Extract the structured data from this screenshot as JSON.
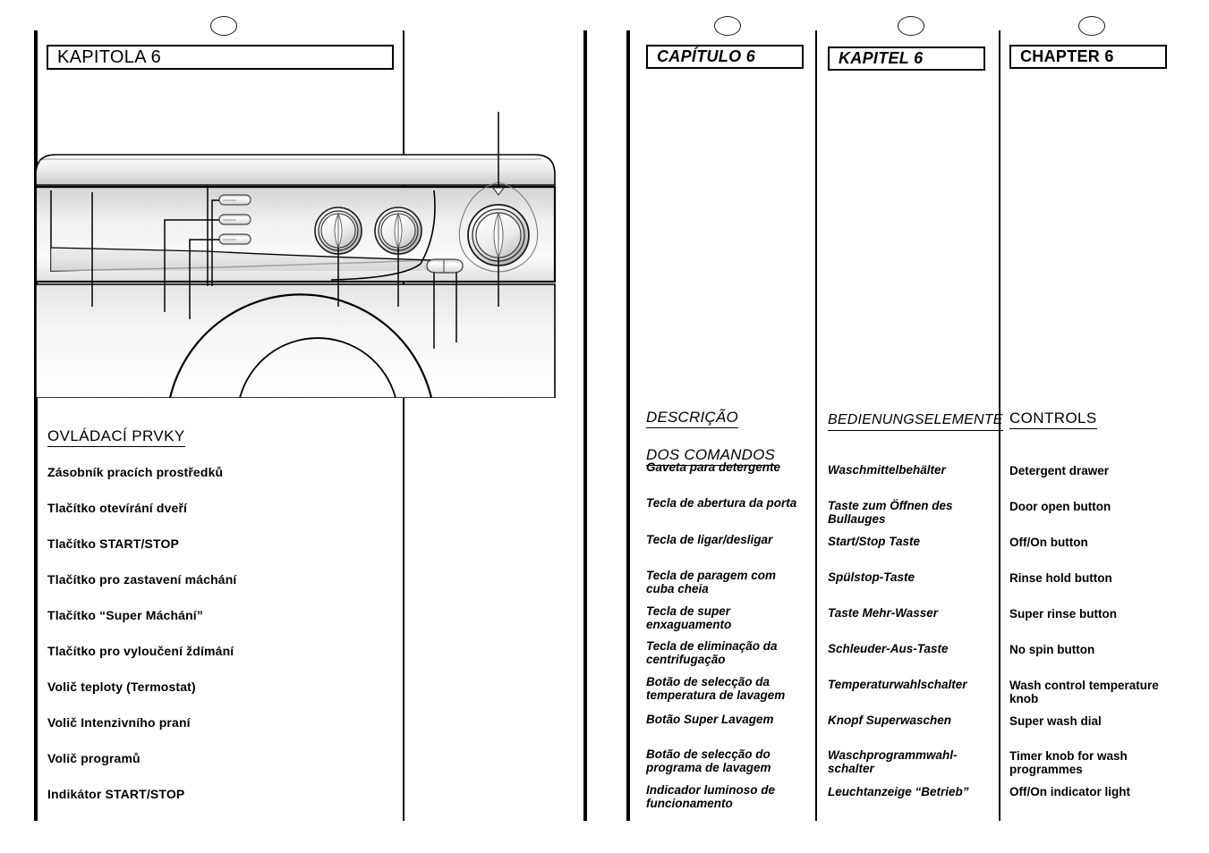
{
  "document": {
    "kind": "appliance-manual-spread",
    "page_markers": 4
  },
  "columns": {
    "cz": {
      "chapter": "KAPITOLA 6",
      "heading": "OVLÁDACÍ PRVKY",
      "items": [
        "Zásobník pracích prostředků",
        "Tlačítko otevírání dveří",
        "Tlačítko START/STOP",
        "Tlačítko pro zastavení máchání",
        "Tlačítko “Super Máchání”",
        "Tlačítko pro vyloučení ždímání",
        "Volič teploty (Termostat)",
        "Volič Intenzivního praní",
        "Volič programů",
        "Indikátor START/STOP"
      ]
    },
    "pt": {
      "chapter": "CAPÍTULO 6",
      "heading_line1": "DESCRIÇÃO",
      "heading_line2": "DOS COMANDOS",
      "items": [
        "Gaveta para detergente",
        "Tecla de abertura da porta",
        "Tecla de ligar/desligar",
        "Tecla de paragem com\ncuba cheia",
        "Tecla de super\nenxaguamento",
        "Tecla de eliminação da\ncentrifugação",
        "Botão de selecção da\ntemperatura de lavagem",
        "Botão Super Lavagem",
        "Botão de selecção do\nprograma de lavagem",
        "Indicador luminoso de\nfuncionamento"
      ]
    },
    "de": {
      "chapter": "KAPITEL 6",
      "heading": "BEDIENUNGSELEMENTE",
      "items": [
        "Waschmittelbehälter",
        "Taste zum Öffnen des\nBullauges",
        "Start/Stop Taste",
        "Spülstop-Taste",
        "Taste Mehr-Wasser",
        "Schleuder-Aus-Taste",
        "Temperaturwahlschalter",
        "Knopf Superwaschen",
        "Waschprogrammwahl-\nschalter",
        "Leuchtanzeige “Betrieb”"
      ]
    },
    "en": {
      "chapter": "CHAPTER 6",
      "heading": "CONTROLS",
      "items": [
        "Detergent drawer",
        "Door open button",
        "Off/On button",
        "Rinse hold button",
        "Super rinse button",
        "No spin button",
        "Wash control temperature\nknob",
        "Super wash dial",
        "Timer knob for wash\nprogrammes",
        "Off/On indicator light"
      ]
    }
  },
  "figure": {
    "name": "washing-machine-control-panel-diagram",
    "parts": [
      "detergent-drawer",
      "push-button-1",
      "push-button-2",
      "push-button-3",
      "temperature-knob",
      "super-wash-knob",
      "indicator-light",
      "programme-selector-dial",
      "porthole-door"
    ]
  },
  "colors": {
    "ink": "#000000",
    "paper": "#ffffff",
    "panel_light": "#f2f2f2",
    "panel_mid": "#d8d8d8",
    "panel_dark": "#b4b4b4"
  }
}
